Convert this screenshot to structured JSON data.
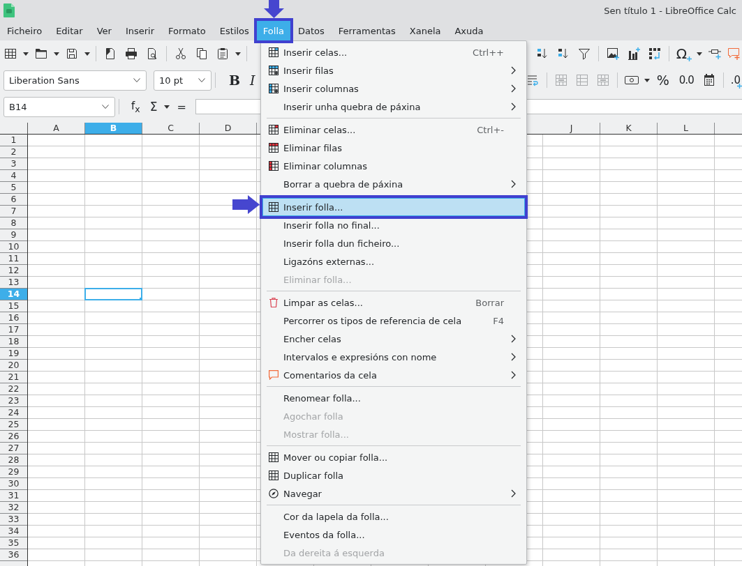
{
  "window": {
    "title": "Sen título 1 - LibreOffice Calc"
  },
  "menubar": [
    {
      "label": "Ficheiro",
      "selected": false,
      "marked": false
    },
    {
      "label": "Editar",
      "selected": false,
      "marked": false
    },
    {
      "label": "Ver",
      "selected": false,
      "marked": false
    },
    {
      "label": "Inserir",
      "selected": false,
      "marked": false
    },
    {
      "label": "Formato",
      "selected": false,
      "marked": false
    },
    {
      "label": "Estilos",
      "selected": false,
      "marked": false
    },
    {
      "label": "Folla",
      "selected": true,
      "marked": true
    },
    {
      "label": "Datos",
      "selected": false,
      "marked": false
    },
    {
      "label": "Ferramentas",
      "selected": false,
      "marked": false
    },
    {
      "label": "Xanela",
      "selected": false,
      "marked": false
    },
    {
      "label": "Axuda",
      "selected": false,
      "marked": false
    }
  ],
  "standard_toolbar": {
    "special_character_button": "Ω"
  },
  "formatting_toolbar": {
    "font_name": "Liberation Sans",
    "font_size": "10 pt",
    "bold_button": "B",
    "italic_button": "I",
    "merge_buttons": [
      {
        "disabled": true
      },
      {
        "disabled": true
      },
      {
        "disabled": true
      }
    ],
    "percent_button": "%",
    "number_button": "0.0",
    "decimal_button": ".0"
  },
  "formula_bar": {
    "name_box": "B14",
    "function_button": "f$_{x}$",
    "sum_button": "Σ",
    "formula_button": "="
  },
  "sheet": {
    "columns_left": [
      {
        "label": "A",
        "selected": false
      },
      {
        "label": "B",
        "selected": true
      },
      {
        "label": "C",
        "selected": false
      },
      {
        "label": "D",
        "selected": false
      }
    ],
    "columns_right": [
      {
        "label": "J",
        "selected": false
      },
      {
        "label": "K",
        "selected": false
      },
      {
        "label": "L",
        "selected": false
      }
    ],
    "rows": [
      {
        "label": "1",
        "selected": false
      },
      {
        "label": "2",
        "selected": false
      },
      {
        "label": "3",
        "selected": false
      },
      {
        "label": "4",
        "selected": false
      },
      {
        "label": "5",
        "selected": false
      },
      {
        "label": "6",
        "selected": false
      },
      {
        "label": "7",
        "selected": false
      },
      {
        "label": "8",
        "selected": false
      },
      {
        "label": "9",
        "selected": false
      },
      {
        "label": "10",
        "selected": false
      },
      {
        "label": "11",
        "selected": false
      },
      {
        "label": "12",
        "selected": false
      },
      {
        "label": "13",
        "selected": false
      },
      {
        "label": "14",
        "selected": true
      },
      {
        "label": "15",
        "selected": false
      },
      {
        "label": "16",
        "selected": false
      },
      {
        "label": "17",
        "selected": false
      },
      {
        "label": "18",
        "selected": false
      },
      {
        "label": "19",
        "selected": false
      },
      {
        "label": "20",
        "selected": false
      },
      {
        "label": "21",
        "selected": false
      },
      {
        "label": "22",
        "selected": false
      },
      {
        "label": "23",
        "selected": false
      },
      {
        "label": "24",
        "selected": false
      },
      {
        "label": "25",
        "selected": false
      },
      {
        "label": "26",
        "selected": false
      },
      {
        "label": "27",
        "selected": false
      },
      {
        "label": "28",
        "selected": false
      },
      {
        "label": "29",
        "selected": false
      },
      {
        "label": "30",
        "selected": false
      },
      {
        "label": "31",
        "selected": false
      },
      {
        "label": "32",
        "selected": false
      },
      {
        "label": "33",
        "selected": false
      },
      {
        "label": "34",
        "selected": false
      },
      {
        "label": "35",
        "selected": false
      },
      {
        "label": "36",
        "selected": false
      }
    ]
  },
  "menu": {
    "groups": [
      {
        "items": [
          {
            "label": "Inserir celas...",
            "shortcut": "Ctrl++",
            "submenu": false,
            "disabled": false,
            "selected": false,
            "marked": false
          },
          {
            "label": "Inserir filas",
            "submenu": true,
            "disabled": false,
            "selected": false,
            "marked": false
          },
          {
            "label": "Inserir columnas",
            "submenu": true,
            "disabled": false,
            "selected": false,
            "marked": false
          },
          {
            "label": "Inserir unha quebra de páxina",
            "submenu": true,
            "disabled": false,
            "selected": false,
            "marked": false
          }
        ]
      },
      {
        "items": [
          {
            "label": "Eliminar celas...",
            "shortcut": "Ctrl+-",
            "submenu": false,
            "disabled": false,
            "selected": false,
            "marked": false
          },
          {
            "label": "Eliminar filas",
            "submenu": false,
            "disabled": false,
            "selected": false,
            "marked": false
          },
          {
            "label": "Eliminar columnas",
            "submenu": false,
            "disabled": false,
            "selected": false,
            "marked": false
          },
          {
            "label": "Borrar a quebra de páxina",
            "submenu": true,
            "disabled": false,
            "selected": false,
            "marked": false
          }
        ]
      },
      {
        "items": [
          {
            "label": "Inserir folla...",
            "submenu": false,
            "disabled": false,
            "selected": true,
            "marked": true
          },
          {
            "label": "Inserir folla no final...",
            "submenu": false,
            "disabled": false,
            "selected": false,
            "marked": false
          },
          {
            "label": "Inserir folla dun ficheiro...",
            "submenu": false,
            "disabled": false,
            "selected": false,
            "marked": false
          },
          {
            "label": "Ligazóns externas...",
            "submenu": false,
            "disabled": false,
            "selected": false,
            "marked": false
          },
          {
            "label": "Eliminar folla...",
            "submenu": false,
            "disabled": true,
            "selected": false,
            "marked": false
          }
        ]
      },
      {
        "items": [
          {
            "label": "Limpar as celas...",
            "shortcut": "Borrar",
            "submenu": false,
            "disabled": false,
            "selected": false,
            "marked": false
          },
          {
            "label": "Percorrer os tipos de referencia de cela",
            "shortcut": "F4",
            "submenu": false,
            "disabled": false,
            "selected": false,
            "marked": false
          },
          {
            "label": "Encher celas",
            "submenu": true,
            "disabled": false,
            "selected": false,
            "marked": false
          },
          {
            "label": "Intervalos e expresións con nome",
            "submenu": true,
            "disabled": false,
            "selected": false,
            "marked": false
          },
          {
            "label": "Comentarios da cela",
            "submenu": true,
            "disabled": false,
            "selected": false,
            "marked": false
          }
        ]
      },
      {
        "items": [
          {
            "label": "Renomear folla...",
            "submenu": false,
            "disabled": false,
            "selected": false,
            "marked": false
          },
          {
            "label": "Agochar folla",
            "submenu": false,
            "disabled": true,
            "selected": false,
            "marked": false
          },
          {
            "label": "Mostrar folla...",
            "submenu": false,
            "disabled": true,
            "selected": false,
            "marked": false
          }
        ]
      },
      {
        "items": [
          {
            "label": "Mover ou copiar folla...",
            "submenu": false,
            "disabled": false,
            "selected": false,
            "marked": false
          },
          {
            "label": "Duplicar folla",
            "submenu": false,
            "disabled": false,
            "selected": false,
            "marked": false
          },
          {
            "label": "Navegar",
            "submenu": true,
            "disabled": false,
            "selected": false,
            "marked": false
          }
        ]
      },
      {
        "items": [
          {
            "label": "Cor da lapela da folla...",
            "submenu": false,
            "disabled": false,
            "selected": false,
            "marked": false
          },
          {
            "label": "Eventos da folla...",
            "submenu": false,
            "disabled": false,
            "selected": false,
            "marked": false
          },
          {
            "label": "Da dereita á esquerda",
            "submenu": false,
            "disabled": true,
            "selected": false,
            "marked": false
          }
        ]
      }
    ]
  }
}
